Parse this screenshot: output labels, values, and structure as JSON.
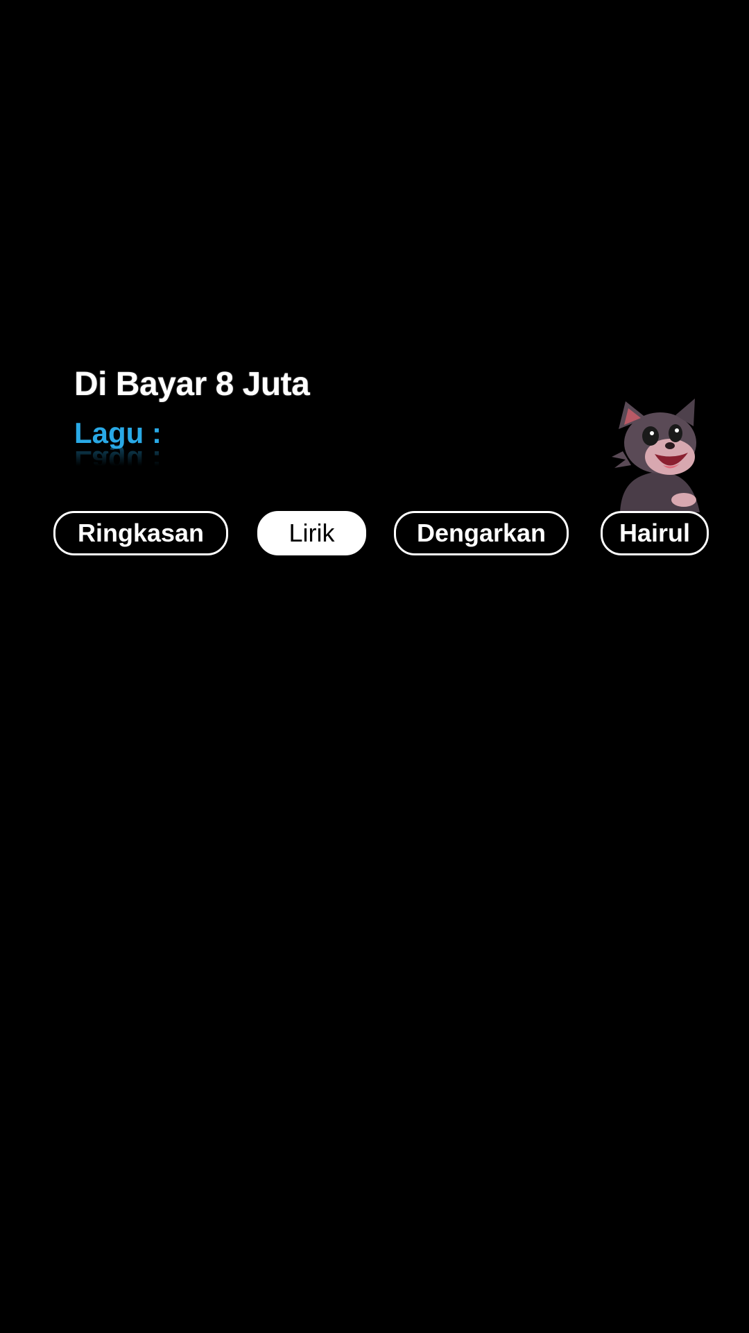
{
  "song": {
    "title": "Di Bayar 8 Juta",
    "label": "Lagu :",
    "label_color": "#29a9e6"
  },
  "mascot": {
    "icon": "cartoon-cat-icon"
  },
  "tabs": [
    {
      "label": "Ringkasan",
      "active": false
    },
    {
      "label": "Lirik",
      "active": true
    },
    {
      "label": "Dengarkan",
      "active": false
    },
    {
      "label": "Hairul",
      "active": false
    }
  ],
  "colors": {
    "background": "#000000",
    "text": "#ffffff",
    "accent": "#29a9e6"
  }
}
